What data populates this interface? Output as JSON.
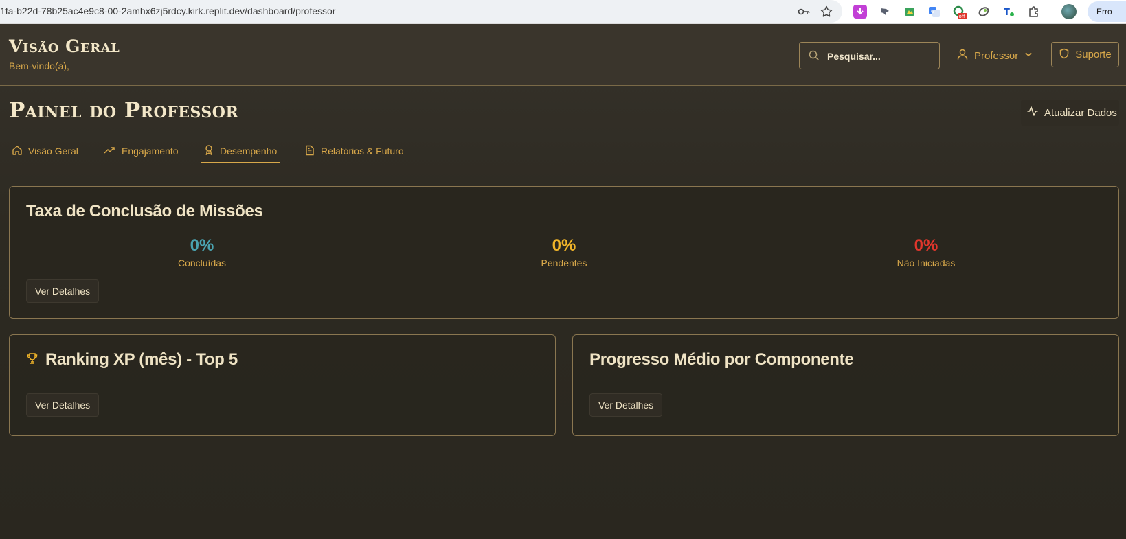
{
  "browser": {
    "url": "1fa-b22d-78b25ac4e9c8-00-2amhx6zj5rdcy.kirk.replit.dev/dashboard/professor",
    "error_label": "Erro"
  },
  "header": {
    "site_title": "Visão Geral",
    "welcome": "Bem-vindo(a),",
    "search_placeholder": "Pesquisar...",
    "user_label": "Professor",
    "support_label": "Suporte"
  },
  "page": {
    "title": "Painel do Professor",
    "refresh_label": "Atualizar Dados"
  },
  "tabs": [
    {
      "label": "Visão Geral",
      "icon": "home-icon"
    },
    {
      "label": "Engajamento",
      "icon": "trending-up-icon"
    },
    {
      "label": "Desempenho",
      "icon": "award-icon",
      "active": true
    },
    {
      "label": "Relatórios & Futuro",
      "icon": "file-text-icon"
    }
  ],
  "mission_card": {
    "title": "Taxa de Conclusão de Missões",
    "stats": [
      {
        "value": "0%",
        "label": "Concluídas",
        "color": "#4aa3b0"
      },
      {
        "value": "0%",
        "label": "Pendentes",
        "color": "#f0b429"
      },
      {
        "value": "0%",
        "label": "Não Iniciadas",
        "color": "#e0362c"
      }
    ],
    "details_label": "Ver Detalhes"
  },
  "ranking_card": {
    "title": "Ranking XP (mês) - Top 5",
    "icon": "trophy-icon",
    "details_label": "Ver Detalhes"
  },
  "progress_card": {
    "title": "Progresso Médio por Componente",
    "details_label": "Ver Detalhes"
  },
  "colors": {
    "accent": "#d8a84a",
    "background": "#2b2820",
    "border": "#8a7650"
  }
}
